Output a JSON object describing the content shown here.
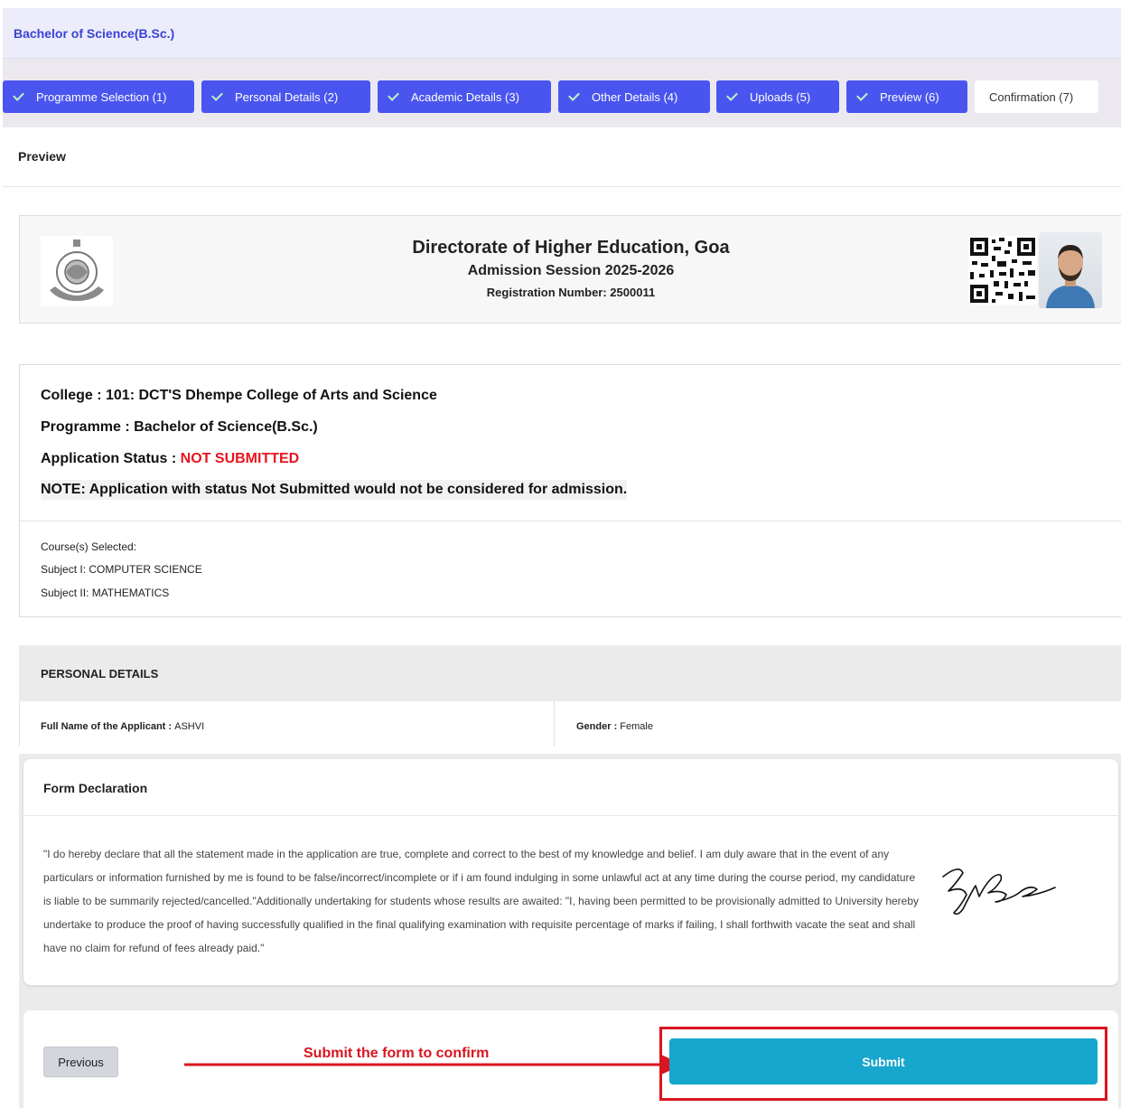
{
  "programme_header": {
    "title": "Bachelor of Science(B.Sc.)"
  },
  "steps": [
    {
      "label": "Programme Selection (1)",
      "completed": true
    },
    {
      "label": "Personal Details (2)",
      "completed": true
    },
    {
      "label": "Academic Details (3)",
      "completed": true
    },
    {
      "label": "Other Details (4)",
      "completed": true
    },
    {
      "label": "Uploads (5)",
      "completed": true
    },
    {
      "label": "Preview (6)",
      "completed": true
    },
    {
      "label": "Confirmation (7)",
      "completed": false
    }
  ],
  "page": {
    "section_title": "Preview"
  },
  "header_card": {
    "title": "Directorate of Higher Education, Goa",
    "session": "Admission Session 2025-2026",
    "registration": "Registration Number: 2500011"
  },
  "summary": {
    "college": "College : 101: DCT'S Dhempe College of Arts and Science",
    "programme": "Programme : Bachelor of Science(B.Sc.)",
    "status_label": "Application Status : ",
    "status_value": "NOT SUBMITTED",
    "note": "NOTE: Application with status Not Submitted would not be considered for admission.",
    "courses_heading": "Course(s) Selected:",
    "subject_1": "Subject I: COMPUTER SCIENCE",
    "subject_2": "Subject II: MATHEMATICS"
  },
  "personal_details": {
    "heading": "PERSONAL DETAILS",
    "name_label": "Full Name of the Applicant : ",
    "name_value": "ASHVI",
    "gender_label": "Gender : ",
    "gender_value": "Female"
  },
  "declaration": {
    "heading": "Form Declaration",
    "text": "\"I do hereby declare that all the statement made in the application are true, complete and correct to the best of my knowledge and belief. I am duly aware that in the event of any particulars or information furnished by me is found to be false/incorrect/incomplete or if i am found indulging in some unlawful act at any time during the course period, my candidature is liable to be summarily rejected/cancelled.\"Additionally undertaking for students whose results are awaited: \"I, having been permitted to be provisionally admitted to University hereby undertake to produce the proof of having successfully qualified in the final qualifying examination with requisite percentage of marks if failing, I shall forthwith vacate the seat and shall have no claim for refund of fees already paid.\""
  },
  "actions": {
    "previous_label": "Previous",
    "submit_label": "Submit",
    "annotation": "Submit the form to confirm"
  },
  "colors": {
    "step_active": "#4a55ef",
    "submit": "#17a6cd",
    "status_red": "#e8141f",
    "annotation_red": "#d9151f"
  }
}
